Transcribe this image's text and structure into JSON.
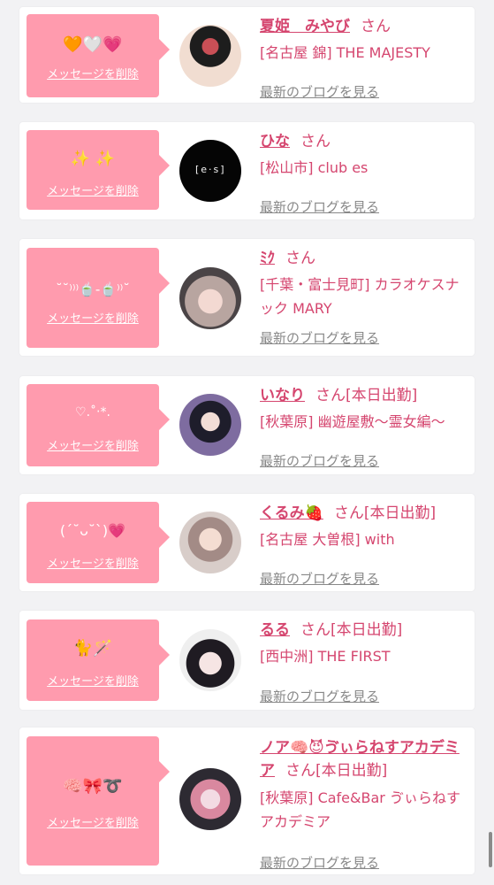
{
  "messages": [
    {
      "emoji": "🧡🤍💗",
      "delete_label": "メッセージを削除",
      "name": "夏姫　みやび",
      "san": "さん",
      "status": "",
      "shop": "[名古屋 錦] THE MAJESTY",
      "blog_label": "最新のブログを見る"
    },
    {
      "emoji": "✨ ✨",
      "delete_label": "メッセージを削除",
      "name": "ひな",
      "san": "さん",
      "status": "",
      "shop": "[松山市] club es",
      "blog_label": "最新のブログを見る"
    },
    {
      "emoji": "˘˘⁾⁾⁾🍵-🍵⁾⁾˘",
      "delete_label": "メッセージを削除",
      "name": "ﾐｸ",
      "san": "さん",
      "status": "",
      "shop": "[千葉・富士見町] カラオケスナック MARY",
      "blog_label": "最新のブログを見る"
    },
    {
      "emoji": "♡.˚‧*.",
      "delete_label": "メッセージを削除",
      "name": "いなり",
      "san": "さん",
      "status": "[本日出勤]",
      "shop": "[秋葉原] 幽遊屋敷～霊女編～",
      "blog_label": "最新のブログを見る"
    },
    {
      "emoji": "(ˊ˘ᴗ˘ˋ)💗",
      "delete_label": "メッセージを削除",
      "name": "くるみ🍓",
      "san": "さん",
      "status": "[本日出勤]",
      "shop": "[名古屋 大曽根] with",
      "blog_label": "最新のブログを見る"
    },
    {
      "emoji": "🐈🪄",
      "delete_label": "メッセージを削除",
      "name": "るる",
      "san": "さん",
      "status": "[本日出勤]",
      "shop": "[西中洲] THE FIRST",
      "blog_label": "最新のブログを見る"
    },
    {
      "emoji": "🧠🎀➰",
      "delete_label": "メッセージを削除",
      "name": "ノア🧠😈ゔぃらねすアカデミア",
      "san": "さん",
      "status": "[本日出勤]",
      "shop": "[秋葉原] Cafe&Bar ゔぃらねすアカデミア",
      "blog_label": "最新のブログを見る"
    }
  ]
}
